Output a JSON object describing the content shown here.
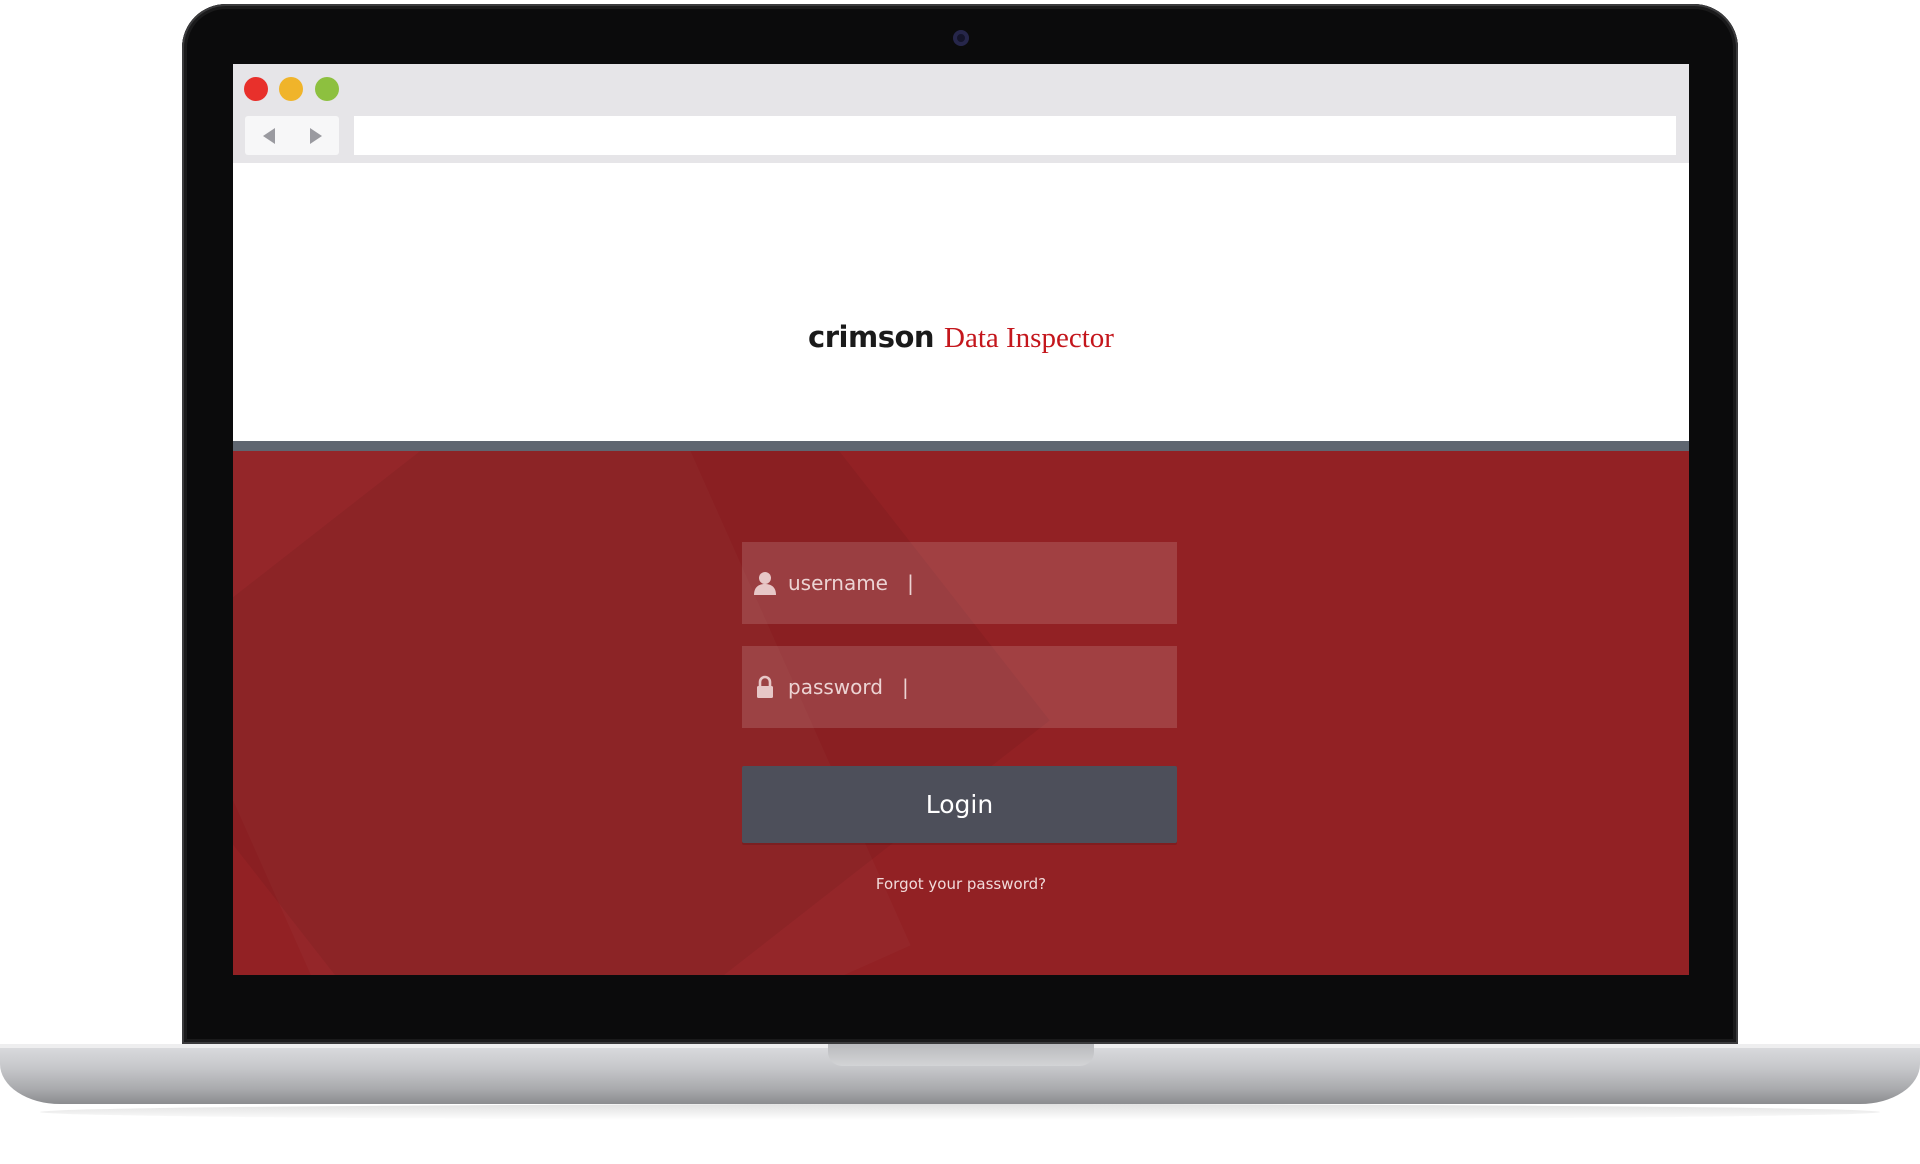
{
  "browser": {
    "address_bar_value": ""
  },
  "logo": {
    "brand": "crimson",
    "product": "Data Inspector"
  },
  "login": {
    "username_placeholder": "username   |",
    "password_placeholder": "password   |",
    "login_label": "Login",
    "forgot_label": "Forgot your password?"
  },
  "icons": {
    "back": "chevron-left-icon",
    "forward": "chevron-right-icon",
    "user": "user-icon",
    "lock": "lock-icon"
  },
  "colors": {
    "traffic_close": "#e8302b",
    "traffic_minimize": "#f0b42a",
    "traffic_maximize": "#8dc03f",
    "brand_red": "#c4161c",
    "login_background": "#922124",
    "divider": "#5f6670",
    "login_button": "#4d4f5a"
  }
}
